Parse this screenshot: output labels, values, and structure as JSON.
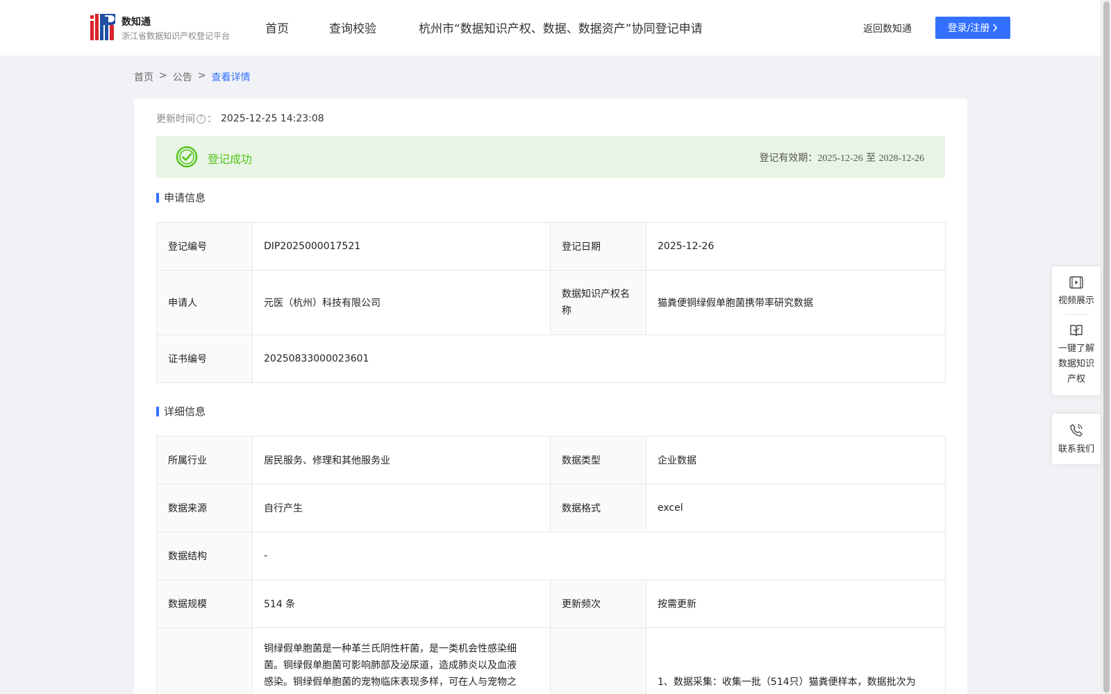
{
  "header": {
    "brand_title": "数知通",
    "brand_subtitle": "浙江省数据知识产权登记平台",
    "nav": {
      "home": "首页",
      "query": "查询校验",
      "hangzhou": "杭州市“数据知识产权、数据、数据资产”协同登记申请"
    },
    "back_link": "返回数知通",
    "login_label": "登录/注册"
  },
  "breadcrumb": {
    "home": "首页",
    "sep": ">",
    "notice": "公告",
    "current": "查看详情"
  },
  "update": {
    "label": "更新时间",
    "help_glyph": "?",
    "colon": "：",
    "value": "2025-12-25 14:23:08"
  },
  "status": {
    "text": "登记成功",
    "validity_label": "登记有效期：",
    "validity_start": "2025-12-26",
    "validity_to": "至",
    "validity_end": "2028-12-26",
    "color": "#52c41a"
  },
  "application": {
    "title": "申请信息",
    "reg_no_label": "登记编号",
    "reg_no": "DIP2025000017521",
    "reg_date_label": "登记日期",
    "reg_date": "2025-12-26",
    "applicant_label": "申请人",
    "applicant": "元医（杭州）科技有限公司",
    "ip_name_label": "数据知识产权名称",
    "ip_name": "猫粪便铜绿假单胞菌携带率研究数据",
    "cert_no_label": "证书编号",
    "cert_no": "20250833000023601"
  },
  "details": {
    "title": "详细信息",
    "industry_label": "所属行业",
    "industry": "居民服务、修理和其他服务业",
    "data_type_label": "数据类型",
    "data_type": "企业数据",
    "source_label": "数据来源",
    "source": "自行产生",
    "format_label": "数据格式",
    "format": "excel",
    "structure_label": "数据结构",
    "structure": "-",
    "scale_label": "数据规模",
    "scale": "514 条",
    "frequency_label": "更新频次",
    "frequency": "按需更新",
    "desc_line1": "铜绿假单胞菌是一种革兰氏阴性杆菌，是一类机会性感染细",
    "desc_line2": "菌。铜绿假单胞菌可影响肺部及泌尿道，造成肺炎以及血液",
    "desc_line3": "感染。铜绿假单胞菌的宠物临床表现多样，可在人与宠物之",
    "process_line1": "1、数据采集：收集一批（514只）猫粪便样本，数据批次为"
  },
  "float_panel": {
    "video": "视频展示",
    "learn_line1": "一键了解",
    "learn_line2": "数据知识",
    "learn_line3": "产权",
    "contact": "联系我们"
  },
  "colors": {
    "accent": "#3370ff",
    "success_bg": "#e8f5e4",
    "page_bg": "#f0f2f5"
  }
}
